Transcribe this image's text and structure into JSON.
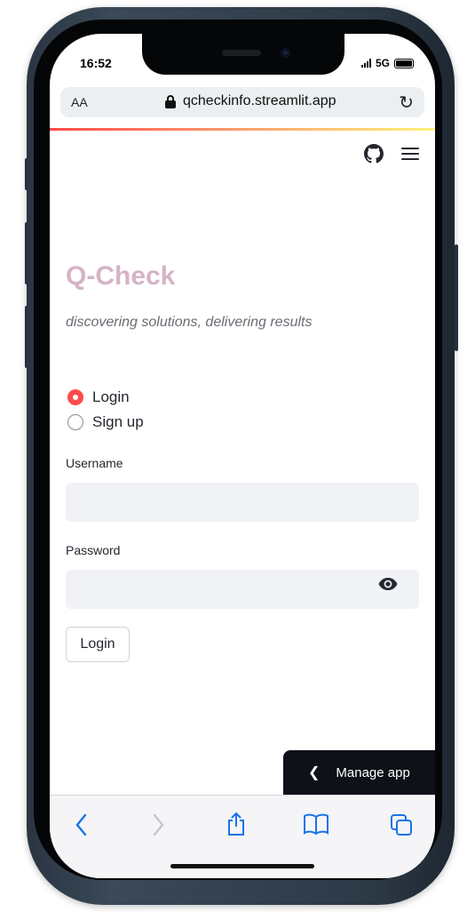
{
  "status_bar": {
    "time": "16:52",
    "network": "5G"
  },
  "browser": {
    "aa_label": "AA",
    "url": "qcheckinfo.streamlit.app"
  },
  "app": {
    "title": "Q-Check",
    "subtitle": "discovering solutions, delivering results",
    "mode_options": [
      {
        "label": "Login",
        "selected": true
      },
      {
        "label": "Sign up",
        "selected": false
      }
    ],
    "username_label": "Username",
    "username_value": "",
    "password_label": "Password",
    "password_value": "",
    "login_button": "Login"
  },
  "manage_app_label": "Manage app",
  "icons": [
    "github-icon",
    "menu-icon",
    "eye-icon",
    "back-icon",
    "forward-icon",
    "share-icon",
    "bookmarks-icon",
    "tabs-icon",
    "reload-icon",
    "lock-icon"
  ],
  "colors": {
    "accent": "#ff4b4b",
    "title": "#d6b3c6",
    "toolbar_icons": "#1a73e8",
    "input_bg": "#f0f2f6"
  }
}
